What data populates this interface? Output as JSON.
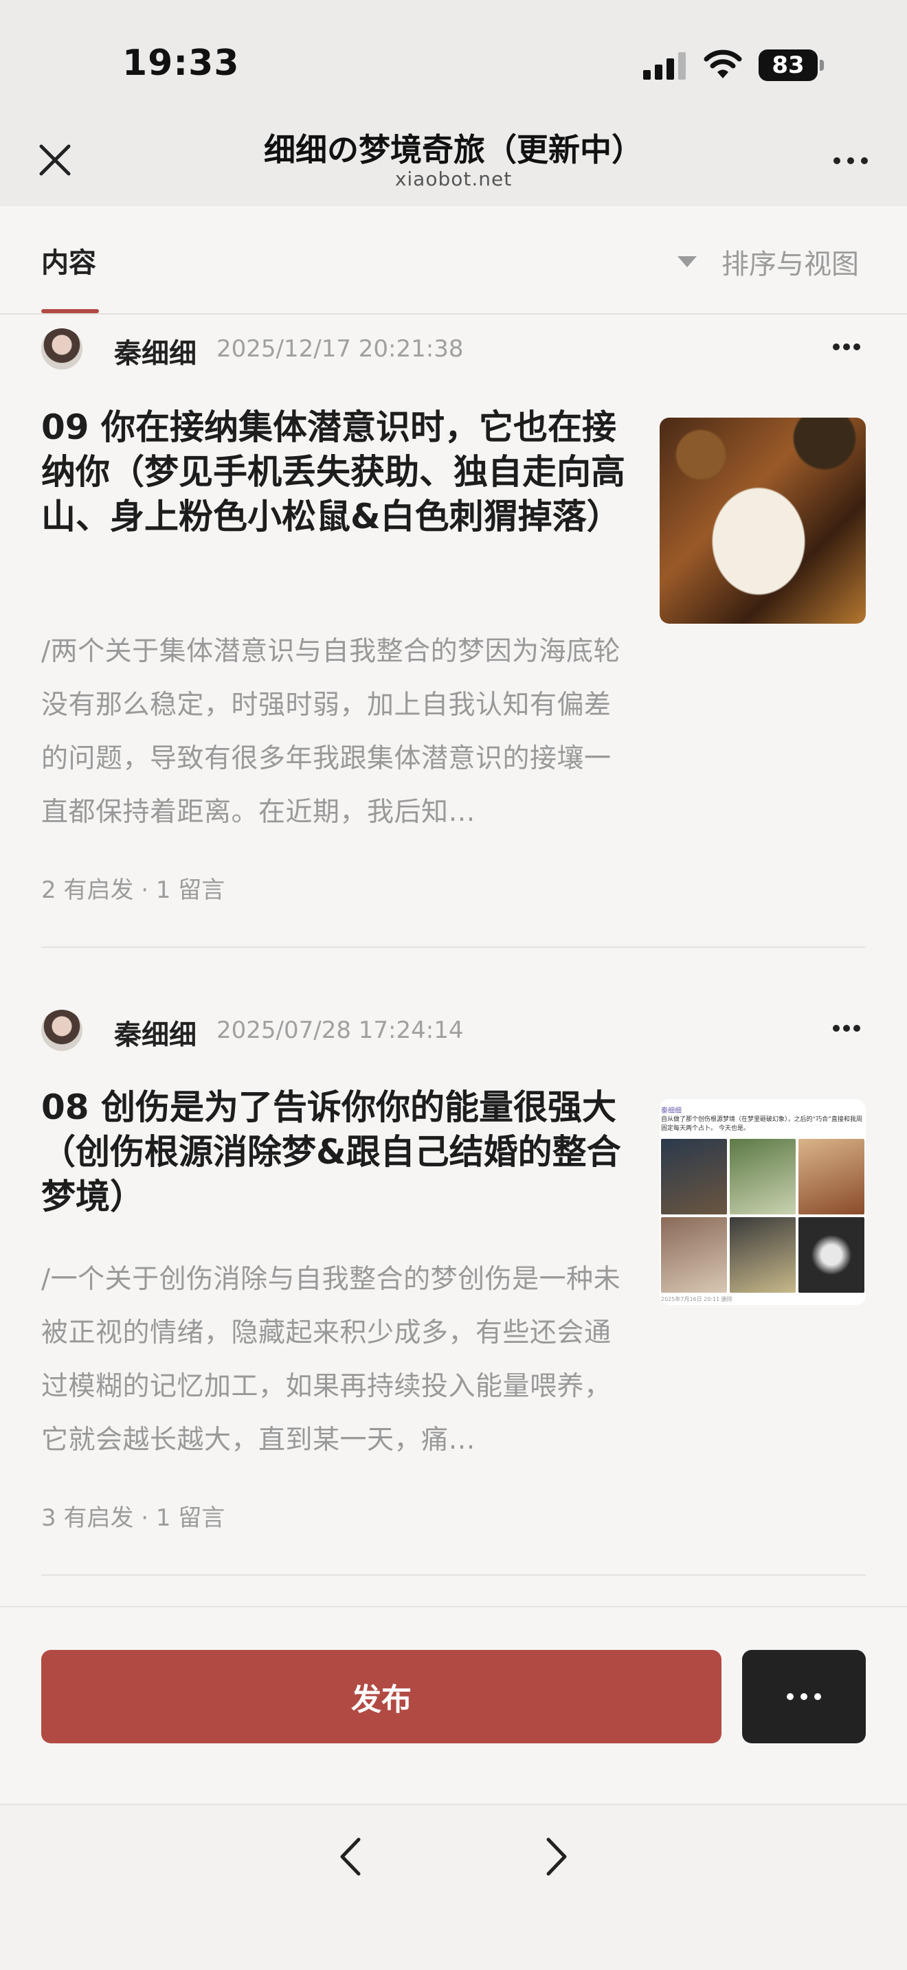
{
  "status_bar": {
    "time": "19:33",
    "battery": "83"
  },
  "nav": {
    "title": "细细の梦境奇旅（更新中）",
    "subtitle": "xiaobot.net"
  },
  "tabs": {
    "active": "内容",
    "sort_view": "排序与视图"
  },
  "posts": [
    {
      "author": "秦细细",
      "time": "2025/12/17 20:21:38",
      "title": "09 你在接纳集体潜意识时，它也在接纳你（梦见手机丢失获助、独自走向高山、身上粉色小松鼠&白色刺猬掉落）",
      "excerpt": "/两个关于集体潜意识与自我整合的梦因为海底轮没有那么稳定，时强时弱，加上自我认知有偏差的问题，导致有很多年我跟集体潜意识的接壤一直都保持着距离。在近期，我后知…",
      "meta": "2 有启发 · 1 留言"
    },
    {
      "author": "秦细细",
      "time": "2025/07/28 17:24:14",
      "title": "08 创伤是为了告诉你你的能量很强大（创伤根源消除梦&跟自己结婚的整合梦境）",
      "excerpt": "/一个关于创伤消除与自我整合的梦创伤是一种未被正视的情绪，隐藏起来积少成多，有些还会通过模糊的记忆加工，如果再持续投入能量喂养，它就会越长越大，直到某一天，痛…",
      "meta": "3 有启发 · 1 留言",
      "thumb": {
        "author": "秦细细",
        "text": "自从做了那个创伤根源梦境（在梦里砸破幻象），之后的“巧合”直接和我周固定每天两个占卜。 今天也是。",
        "footer": "2025年7月16日 20:11  删除"
      }
    }
  ],
  "actions": {
    "publish": "发布"
  },
  "colors": {
    "accent": "#b24a44",
    "dark_button": "#222222",
    "background": "#f6f5f3"
  }
}
